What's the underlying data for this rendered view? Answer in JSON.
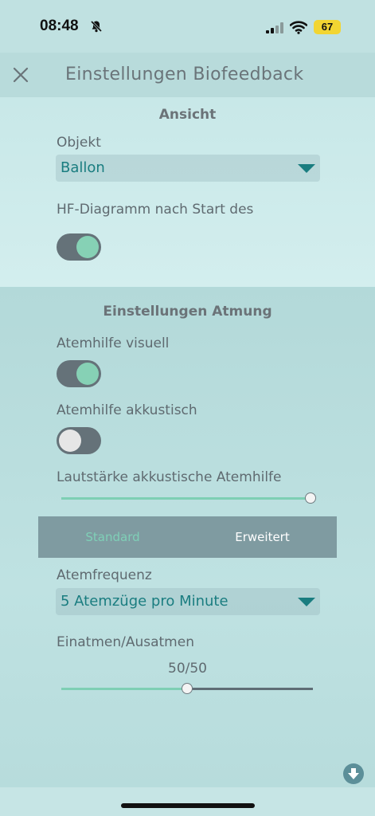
{
  "status_bar": {
    "time": "08:48",
    "battery": "67"
  },
  "header": {
    "title": "Einstellungen Biofeedback"
  },
  "view_section": {
    "title": "Ansicht",
    "object_label": "Objekt",
    "object_value": "Ballon",
    "hf_label": "HF-Diagramm nach Start des",
    "hf_toggle_on": true
  },
  "breathing_section": {
    "title": "Einstellungen Atmung",
    "visual_label": "Atemhilfe visuell",
    "visual_toggle_on": true,
    "acoustic_label": "Atemhilfe akkustisch",
    "acoustic_toggle_on": false,
    "volume_label": "Lautstärke akkustische Atemhilfe",
    "volume_level": 1.0,
    "tabs": [
      {
        "label": "Standard",
        "selected": false
      },
      {
        "label": "Erweitert",
        "selected": true
      }
    ],
    "frequency_label": "Atemfrequenz",
    "frequency_value": "5 Atemzüge pro Minute",
    "ratio_label": "Einatmen/Ausatmen",
    "ratio_value": "50/50",
    "ratio_level": 0.5
  },
  "colors": {
    "accent": "#1a7d80",
    "toggle_on_knob": "#86d1b5",
    "toggle_track": "#657279"
  }
}
